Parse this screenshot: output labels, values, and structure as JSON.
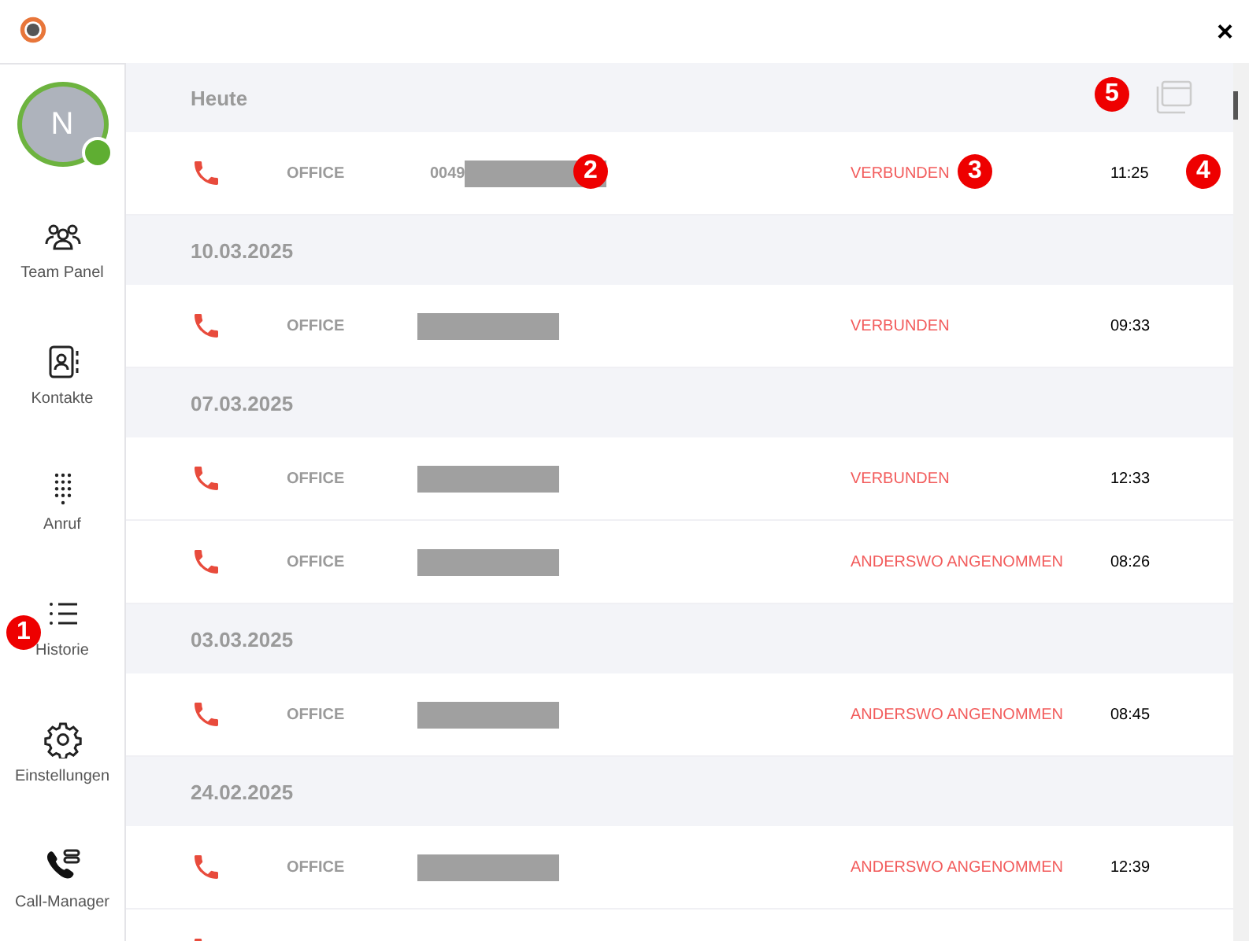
{
  "window": {
    "close": "×"
  },
  "sidebar": {
    "avatar": {
      "initial": "N",
      "online": true
    },
    "items": [
      {
        "label": "Team Panel"
      },
      {
        "label": "Kontakte"
      },
      {
        "label": "Anruf"
      },
      {
        "label": "Historie"
      },
      {
        "label": "Einstellungen"
      },
      {
        "label": "Call-Manager"
      }
    ]
  },
  "history": [
    {
      "date": "Heute",
      "calls": [
        {
          "line": "OFFICE",
          "number": "0049",
          "status": "VERBUNDEN",
          "time": "11:25"
        }
      ]
    },
    {
      "date": "10.03.2025",
      "calls": [
        {
          "line": "OFFICE",
          "status": "VERBUNDEN",
          "time": "09:33"
        }
      ]
    },
    {
      "date": "07.03.2025",
      "calls": [
        {
          "line": "OFFICE",
          "status": "VERBUNDEN",
          "time": "12:33"
        },
        {
          "line": "OFFICE",
          "status": "ANDERSWO ANGENOMMEN",
          "time": "08:26"
        }
      ]
    },
    {
      "date": "03.03.2025",
      "calls": [
        {
          "line": "OFFICE",
          "status": "ANDERSWO ANGENOMMEN",
          "time": "08:45"
        }
      ]
    },
    {
      "date": "24.02.2025",
      "calls": [
        {
          "line": "OFFICE",
          "status": "ANDERSWO ANGENOMMEN",
          "time": "12:39"
        }
      ]
    }
  ],
  "callouts": [
    "1",
    "2",
    "3",
    "4",
    "5"
  ]
}
